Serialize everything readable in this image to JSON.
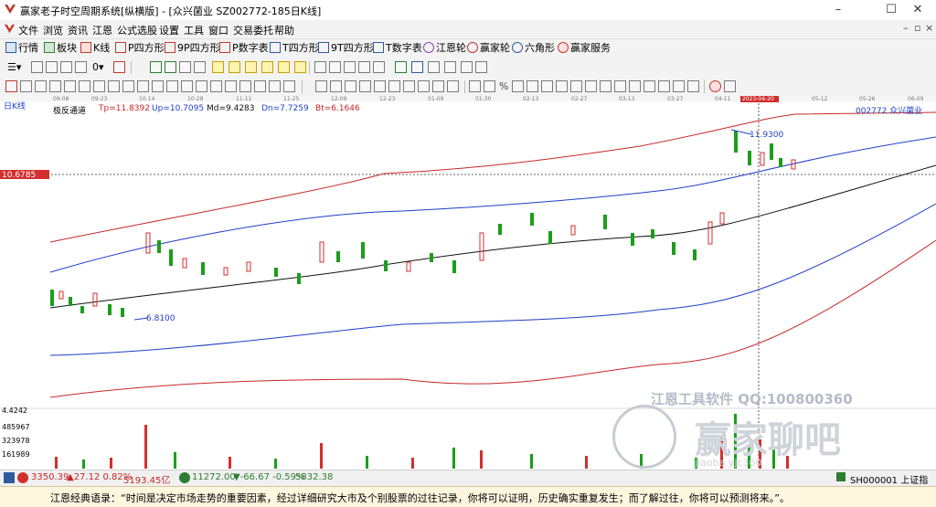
{
  "window": {
    "title": "赢家老子时空周期系统[纵横版] - [众兴菌业  SZ002772-185日K线]",
    "minimize": "–",
    "maximize": "☐",
    "close": "✕"
  },
  "menu": [
    "文件",
    "浏览",
    "资讯",
    "江恩",
    "公式选股",
    "设置",
    "工具",
    "窗口",
    "交易委托",
    "帮助"
  ],
  "mdi": {
    "min": "–",
    "restore": "▫",
    "close": "×"
  },
  "toolbar1": [
    "行情",
    "板块",
    "K线",
    "P四方形",
    "9P四方形",
    "P数字表",
    "T四方形",
    "9T四方形",
    "T数字表",
    "江恩轮",
    "赢家轮",
    "六角形",
    "赢家服务"
  ],
  "toolbar2": {
    "period_select": "0"
  },
  "chart": {
    "period_label": "日K线",
    "indicator_name": "极反通道",
    "tp": "Tp=11.8392",
    "up": "Up=10.7095",
    "md": "Md=9.4283",
    "dn": "Dn=7.7259",
    "bt": "Bt=6.1646",
    "stock": "002772  众兴菌业",
    "price_label": "10.6785",
    "high_label": "11.9300",
    "low_label": "6.8100",
    "vol_max": "4.4242",
    "vol_ticks": [
      "485967",
      "323978",
      "161989"
    ],
    "date_axis": [
      "09-08",
      "09-23",
      "10-14",
      "10-28",
      "11-11",
      "11-25",
      "12-09",
      "12-23",
      "01-09",
      "01-30",
      "02-13",
      "02-27",
      "03-13",
      "03-27",
      "04-11",
      "2023-04-20",
      "05-12",
      "05-26",
      "06-09"
    ],
    "watermark_line1": "江恩工具软件  QQ:100800360",
    "watermark_line2": "赢家聊吧",
    "watermark_line3": "jiaoba.yjc360"
  },
  "status": {
    "sh_index": "3350.39",
    "sh_change": "▲27.12 0.82%",
    "sh_amount": "5193.45亿",
    "sz_index": "11272.00",
    "sz_change": "▼-66.67 -0.59%",
    "sz_amount": "5832.38",
    "right_code": "SH000001 上证指数"
  },
  "quote": {
    "text": "江恩经典语录：“时间是决定市场走势的重要因素，经过详细研究大市及个别股票的过往记录，你将可以证明，历史确实重复发生；而了解过往，你将可以预测将来。”。"
  }
}
